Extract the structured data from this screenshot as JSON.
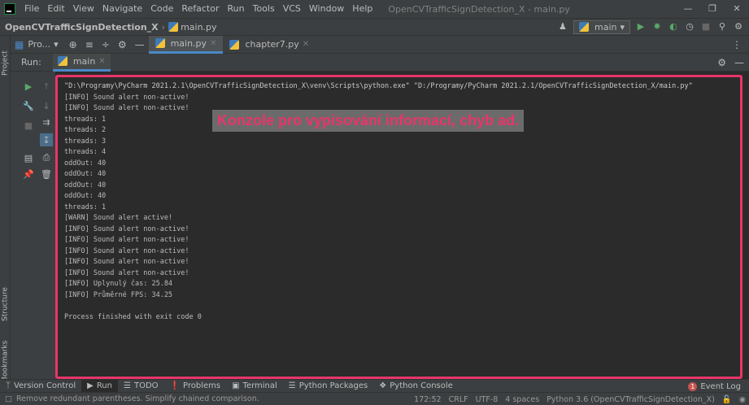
{
  "menu": {
    "items": [
      "File",
      "Edit",
      "View",
      "Navigate",
      "Code",
      "Refactor",
      "Run",
      "Tools",
      "VCS",
      "Window",
      "Help"
    ],
    "window_title": "OpenCVTrafficSignDetection_X - main.py"
  },
  "navbar": {
    "project": "OpenCVTrafficSignDetection_X",
    "file": "main.py",
    "run_config": "main"
  },
  "left_strip": {
    "project_tab": "Project",
    "structure_tab": "Structure",
    "bookmarks_tab": "Bookmarks"
  },
  "tabs": {
    "project_view": "Pro...",
    "files": [
      {
        "name": "main.py",
        "active": true
      },
      {
        "name": "chapter7.py",
        "active": false
      }
    ]
  },
  "run": {
    "label": "Run:",
    "tab": "main"
  },
  "console": {
    "lines": [
      "\"D:\\Programy\\PyCharm 2021.2.1\\OpenCVTrafficSignDetection_X\\venv\\Scripts\\python.exe\" \"D:/Programy/PyCharm 2021.2.1/OpenCVTrafficSignDetection_X/main.py\"",
      "[INFO] Sound alert non-active!",
      "[INFO] Sound alert non-active!",
      "threads: 1",
      "threads: 2",
      "threads: 3",
      "threads: 4",
      "oddOut: 40",
      "oddOut: 40",
      "oddOut: 40",
      "oddOut: 40",
      "threads: 1",
      "[WARN] Sound alert active!",
      "[INFO] Sound alert non-active!",
      "[INFO] Sound alert non-active!",
      "[INFO] Sound alert non-active!",
      "[INFO] Sound alert non-active!",
      "[INFO] Sound alert non-active!",
      "[INFO] Uplynulý čas: 25.84",
      "[INFO] Průměrné FPS: 34.25",
      "",
      "Process finished with exit code 0"
    ],
    "annotation": "Konzole pro vypisování informací, chyb ad."
  },
  "bottom_tools": {
    "items": [
      "Version Control",
      "Run",
      "TODO",
      "Problems",
      "Terminal",
      "Python Packages",
      "Python Console"
    ],
    "event_log": "Event Log",
    "event_count": "1"
  },
  "status": {
    "message": "Remove redundant parentheses. Simplify chained comparison.",
    "position": "172:52",
    "line_sep": "CRLF",
    "encoding": "UTF-8",
    "indent": "4 spaces",
    "interpreter": "Python 3.6 (OpenCVTrafficSignDetection_X)"
  },
  "colors": {
    "highlight_border": "#e8356a",
    "accent": "#4a88c7"
  }
}
